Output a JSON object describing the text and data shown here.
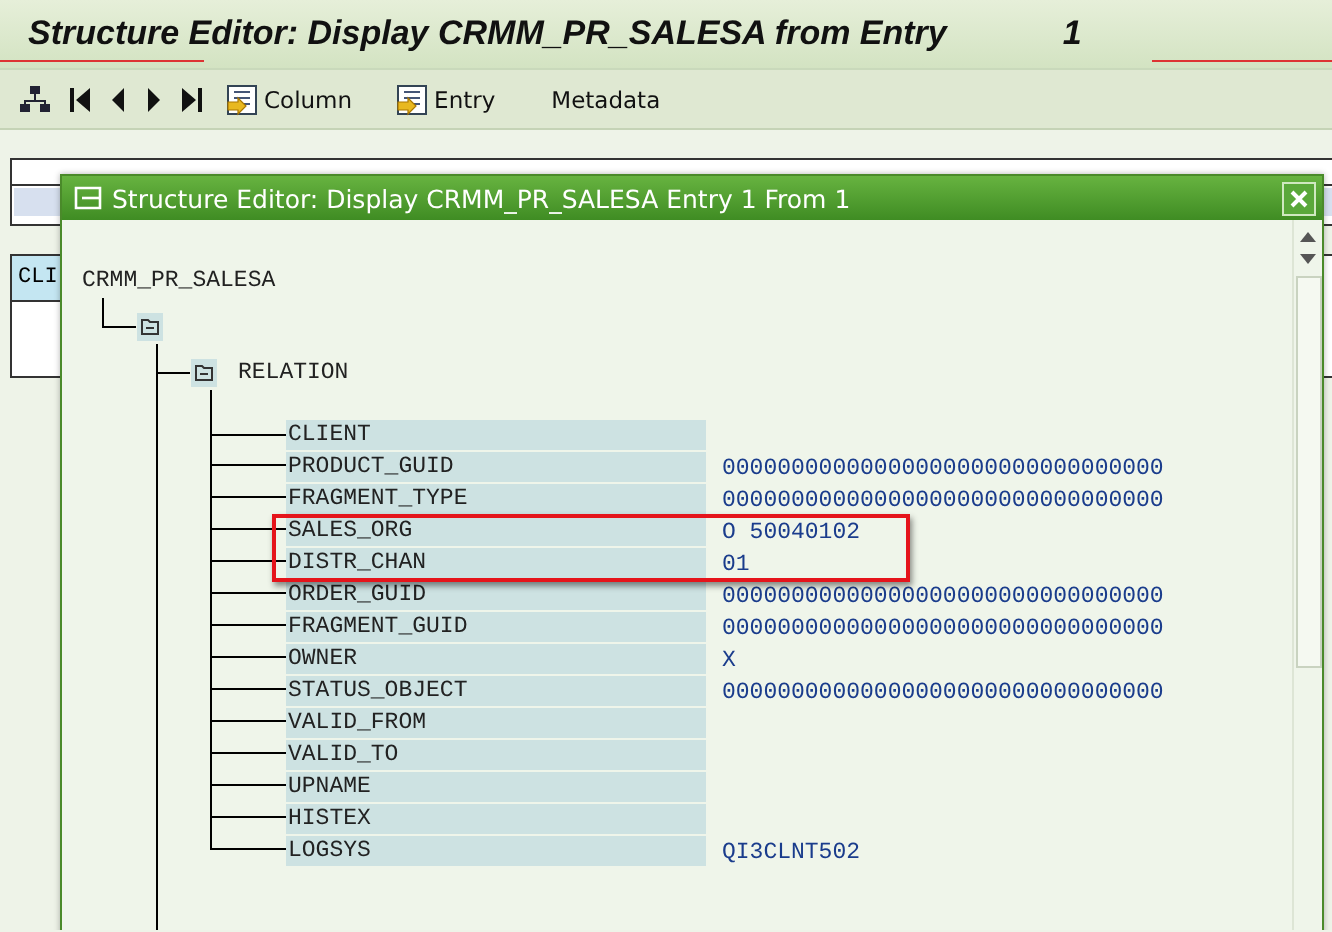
{
  "window": {
    "title": "Structure Editor: Display CRMM_PR_SALESA from Entry",
    "entry_number": "1"
  },
  "toolbar": {
    "buttons": [
      {
        "kind": "icon-text",
        "label": "Column"
      },
      {
        "kind": "icon-text",
        "label": "Entry"
      },
      {
        "kind": "text",
        "label": "Metadata"
      }
    ]
  },
  "background_table": {
    "cell": "CLI"
  },
  "dialog": {
    "title": "Structure Editor: Display CRMM_PR_SALESA Entry 1 From 1",
    "tree": {
      "label": "CRMM_PR_SALESA",
      "children": [
        {
          "kind": "folder",
          "expanded": true,
          "children": [
            {
              "kind": "folder",
              "expanded": true,
              "label": "RELATION",
              "fields": [
                {
                  "name": "CLIENT",
                  "highlighted": false
                },
                {
                  "name": "PRODUCT_GUID",
                  "value": "00000000000000000000000000000000",
                  "highlighted": false
                },
                {
                  "name": "FRAGMENT_TYPE",
                  "value": "00000000000000000000000000000000",
                  "highlighted": false
                },
                {
                  "name": "SALES_ORG",
                  "value": "O 50040102",
                  "highlighted": true
                },
                {
                  "name": "DISTR_CHAN",
                  "value": "01",
                  "highlighted": true
                },
                {
                  "name": "ORDER_GUID",
                  "value": "00000000000000000000000000000000",
                  "highlighted": false
                },
                {
                  "name": "FRAGMENT_GUID",
                  "value": "00000000000000000000000000000000",
                  "highlighted": false
                },
                {
                  "name": "OWNER",
                  "value": "X",
                  "highlighted": false
                },
                {
                  "name": "STATUS_OBJECT",
                  "value": "00000000000000000000000000000000",
                  "highlighted": false
                },
                {
                  "name": "VALID_FROM",
                  "highlighted": false
                },
                {
                  "name": "VALID_TO",
                  "highlighted": false
                },
                {
                  "name": "UPNAME",
                  "highlighted": false
                },
                {
                  "name": "HISTEX",
                  "highlighted": false
                },
                {
                  "name": "LOGSYS",
                  "value": "QI3CLNT502",
                  "highlighted": false
                }
              ]
            }
          ]
        }
      ]
    }
  }
}
